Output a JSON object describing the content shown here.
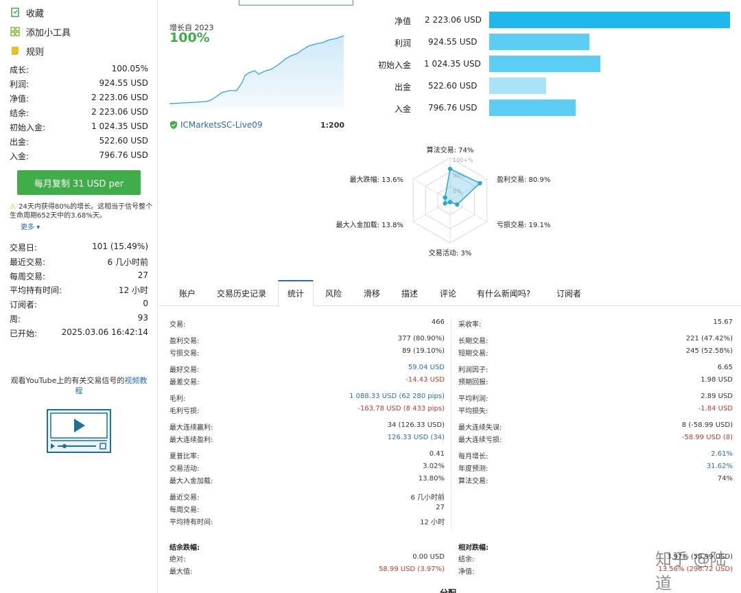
{
  "sidebar": {
    "menu": [
      {
        "label": "收藏",
        "icon": "bookmark-icon"
      },
      {
        "label": "添加小工具",
        "icon": "widgets-icon"
      },
      {
        "label": "规则",
        "icon": "rules-icon"
      }
    ],
    "stats1": [
      {
        "k": "成长:",
        "v": "100.05%"
      },
      {
        "k": "利润:",
        "v": "924.55 USD"
      },
      {
        "k": "净值:",
        "v": "2 223.06 USD"
      },
      {
        "k": "结余:",
        "v": "2 223.06 USD"
      },
      {
        "k": "初始入金:",
        "v": "1 024.35 USD"
      },
      {
        "k": "出金:",
        "v": "522.60 USD"
      },
      {
        "k": "入金:",
        "v": "796.76 USD"
      }
    ],
    "copy_button": "每月复制 31 USD per",
    "note": "24天内获得80%的增长。这相当于信号整个生命周期652天中的3.68%天。",
    "more": "更多",
    "stats2": [
      {
        "k": "交易日:",
        "v": "101 (15.49%)"
      },
      {
        "k": "最近交易:",
        "v": "6 几小时前"
      },
      {
        "k": "每周交易:",
        "v": "27"
      },
      {
        "k": "平均持有时间:",
        "v": "12 小时"
      },
      {
        "k": "订阅者:",
        "v": "0"
      },
      {
        "k": "周:",
        "v": "93"
      },
      {
        "k": "已开始:",
        "v": "2025.03.06 16:42:14"
      }
    ],
    "youtube_text": "观看YouTube上的有关交易信号的",
    "youtube_link": "视频教程"
  },
  "overview": {
    "growth_label": "增长自 2023",
    "growth_value": "100%",
    "broker": "ICMarketsSC-Live09",
    "leverage": "1:200"
  },
  "bars": [
    {
      "label": "净值",
      "value": "2 223.06 USD",
      "amount": 2223.06,
      "color": "#1fb8ee"
    },
    {
      "label": "利润",
      "value": "924.55 USD",
      "amount": 924.55,
      "color": "#5ccdf2"
    },
    {
      "label": "初始入金",
      "value": "1 024.35 USD",
      "amount": 1024.35,
      "color": "#5ccdf2"
    },
    {
      "label": "出金",
      "value": "522.60 USD",
      "amount": 522.6,
      "color": "#a8e3f7"
    },
    {
      "label": "入金",
      "value": "796.76 USD",
      "amount": 796.76,
      "color": "#5ccdf2"
    }
  ],
  "radar": {
    "ring_labels": [
      "100+%",
      "50%",
      "0%"
    ],
    "axes": [
      {
        "label": "算法交易: 74%",
        "value": 74
      },
      {
        "label": "盈利交易: 80.9%",
        "value": 80.9
      },
      {
        "label": "亏损交易: 19.1%",
        "value": 19.1
      },
      {
        "label": "交易活动: 3%",
        "value": 3
      },
      {
        "label": "最大入金加载: 13.8%",
        "value": 13.8
      },
      {
        "label": "最大跌幅: 13.6%",
        "value": 13.6
      }
    ],
    "color": "#29a8d8"
  },
  "tabs": [
    "账户",
    "交易历史记录",
    "统计",
    "风险",
    "滑移",
    "描述",
    "评论",
    "有什么新闻吗?",
    "订阅者"
  ],
  "active_tab": "统计",
  "stats_left": [
    [
      {
        "k": "交易:",
        "v": "466"
      }
    ],
    [
      {
        "k": "盈利交易:",
        "v": "377 (80.90%)"
      },
      {
        "k": "亏损交易:",
        "v": "89 (19.10%)"
      }
    ],
    [
      {
        "k": "最好交易:",
        "v": "59.04 USD",
        "c": "blue"
      },
      {
        "k": "最差交易:",
        "v": "-14.43 USD",
        "c": "red"
      }
    ],
    [
      {
        "k": "毛利:",
        "v": "1 088.33 USD (62 280 pips)",
        "c": "blue"
      },
      {
        "k": "毛利亏损:",
        "v": "-163.78 USD (8 433 pips)",
        "c": "red"
      }
    ],
    [
      {
        "k": "最大连续赢利:",
        "v": "34 (126.33 USD)"
      },
      {
        "k": "最大连续盈利:",
        "v": "126.33 USD (34)",
        "c": "blue"
      }
    ],
    [
      {
        "k": "夏普比率:",
        "v": "0.41"
      },
      {
        "k": "交易活动:",
        "v": "3.02%"
      },
      {
        "k": "最大入金加载:",
        "v": "13.80%"
      }
    ],
    [
      {
        "k": "最近交易:",
        "v": "6 几小时前"
      },
      {
        "k": "每周交易:",
        "v": "27"
      },
      {
        "k": "平均持有时间:",
        "v": "12 小时"
      }
    ]
  ],
  "stats_right": [
    [
      {
        "k": "采收率:",
        "v": "15.67"
      }
    ],
    [
      {
        "k": "长期交易:",
        "v": "221 (47.42%)"
      },
      {
        "k": "短期交易:",
        "v": "245 (52.58%)"
      }
    ],
    [
      {
        "k": "利润因子:",
        "v": "6.65"
      },
      {
        "k": "预期回报:",
        "v": "1.98 USD"
      }
    ],
    [
      {
        "k": "平均利润:",
        "v": "2.89 USD"
      },
      {
        "k": "平均损失:",
        "v": "-1.84 USD",
        "c": "red"
      }
    ],
    [
      {
        "k": "最大连续失误:",
        "v": "8 (-58.99 USD)"
      },
      {
        "k": "最大连续亏损:",
        "v": "-58.99 USD (8)",
        "c": "red"
      }
    ],
    [
      {
        "k": "每月增长:",
        "v": "2.61%",
        "c": "blue"
      },
      {
        "k": "年度预测:",
        "v": "31.62%",
        "c": "blue"
      },
      {
        "k": "算法交易:",
        "v": "74%"
      }
    ]
  ],
  "drawdown_left": {
    "title": "结余跌幅:",
    "rows": [
      {
        "k": "绝对:",
        "v": "0.00 USD"
      },
      {
        "k": "最大值:",
        "v": "58.99 USD (3.97%)",
        "c": "red"
      }
    ]
  },
  "drawdown_right": {
    "title": "相对跌幅:",
    "rows": [
      {
        "k": "结余:",
        "v": "3.97% (58.99 USD)"
      },
      {
        "k": "净值:",
        "v": "13.56% (296.72 USD)",
        "c": "red"
      }
    ]
  },
  "watermark": "知乎 @陆道",
  "bottom_cut": "分配"
}
